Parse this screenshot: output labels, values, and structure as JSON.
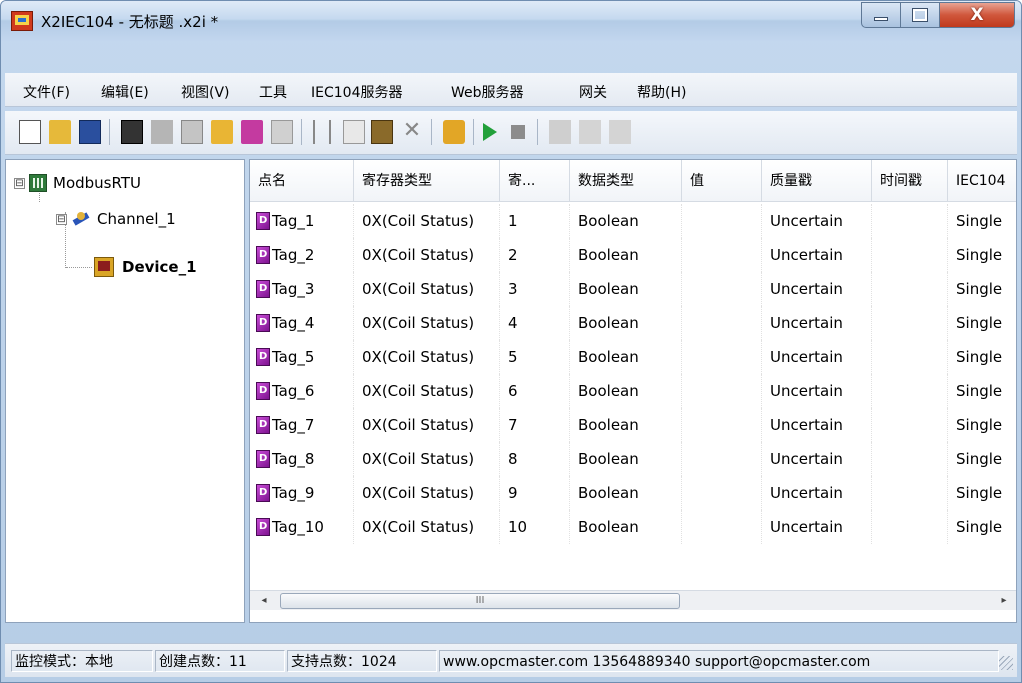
{
  "window": {
    "title": "X2IEC104 - 无标题 .x2i *",
    "close_glyph": "X"
  },
  "menu": [
    "文件(F)",
    "编辑(E)",
    "视图(V)",
    "工具",
    "IEC104服务器",
    "Web服务器",
    "网关",
    "帮助(H)"
  ],
  "toolbar": {
    "icons": [
      "new-file-icon",
      "open-folder-icon",
      "save-icon",
      "calculator-icon",
      "wand-icon",
      "clipboard-list-icon",
      "add-channel-icon",
      "add-device-icon",
      "properties-icon",
      "cut-icon",
      "copy-icon",
      "paste-icon",
      "delete-icon",
      "tag-generator-icon",
      "run-icon",
      "stop-icon",
      "tools-icon",
      "load-icon",
      "up-icon"
    ]
  },
  "tree": {
    "root": "ModbusRTU",
    "channel": "Channel_1",
    "device": "Device_1",
    "root_expander": "⊟",
    "channel_expander": "⊟"
  },
  "grid": {
    "columns": [
      "点名",
      "寄存器类型",
      "寄...",
      "数据类型",
      "值",
      "质量戳",
      "时间戳",
      "IEC104"
    ],
    "rows": [
      {
        "name": "Tag_1",
        "register_type": "0X(Coil Status)",
        "address": "1",
        "data_type": "Boolean",
        "value": "",
        "quality": "Uncertain",
        "timestamp": "",
        "iec104": "Single"
      },
      {
        "name": "Tag_2",
        "register_type": "0X(Coil Status)",
        "address": "2",
        "data_type": "Boolean",
        "value": "",
        "quality": "Uncertain",
        "timestamp": "",
        "iec104": "Single"
      },
      {
        "name": "Tag_3",
        "register_type": "0X(Coil Status)",
        "address": "3",
        "data_type": "Boolean",
        "value": "",
        "quality": "Uncertain",
        "timestamp": "",
        "iec104": "Single"
      },
      {
        "name": "Tag_4",
        "register_type": "0X(Coil Status)",
        "address": "4",
        "data_type": "Boolean",
        "value": "",
        "quality": "Uncertain",
        "timestamp": "",
        "iec104": "Single"
      },
      {
        "name": "Tag_5",
        "register_type": "0X(Coil Status)",
        "address": "5",
        "data_type": "Boolean",
        "value": "",
        "quality": "Uncertain",
        "timestamp": "",
        "iec104": "Single"
      },
      {
        "name": "Tag_6",
        "register_type": "0X(Coil Status)",
        "address": "6",
        "data_type": "Boolean",
        "value": "",
        "quality": "Uncertain",
        "timestamp": "",
        "iec104": "Single"
      },
      {
        "name": "Tag_7",
        "register_type": "0X(Coil Status)",
        "address": "7",
        "data_type": "Boolean",
        "value": "",
        "quality": "Uncertain",
        "timestamp": "",
        "iec104": "Single"
      },
      {
        "name": "Tag_8",
        "register_type": "0X(Coil Status)",
        "address": "8",
        "data_type": "Boolean",
        "value": "",
        "quality": "Uncertain",
        "timestamp": "",
        "iec104": "Single"
      },
      {
        "name": "Tag_9",
        "register_type": "0X(Coil Status)",
        "address": "9",
        "data_type": "Boolean",
        "value": "",
        "quality": "Uncertain",
        "timestamp": "",
        "iec104": "Single"
      },
      {
        "name": "Tag_10",
        "register_type": "0X(Coil Status)",
        "address": "10",
        "data_type": "Boolean",
        "value": "",
        "quality": "Uncertain",
        "timestamp": "",
        "iec104": "Single"
      }
    ],
    "scroll_left": "◂",
    "scroll_right": "▸",
    "scroll_thumb": "III"
  },
  "status": {
    "mode": "监控模式：本地",
    "created_points": "创建点数：11",
    "supported_points": "支持点数：1024",
    "contact": "www.opcmaster.com 13564889340 support@opcmaster.com"
  },
  "colors": {
    "titlebar": "#c5d9ef",
    "close_button": "#c0391c",
    "run_green": "#22a03a",
    "stop_gray": "#8c8c8c",
    "tag_icon": "#9b2aaa"
  }
}
